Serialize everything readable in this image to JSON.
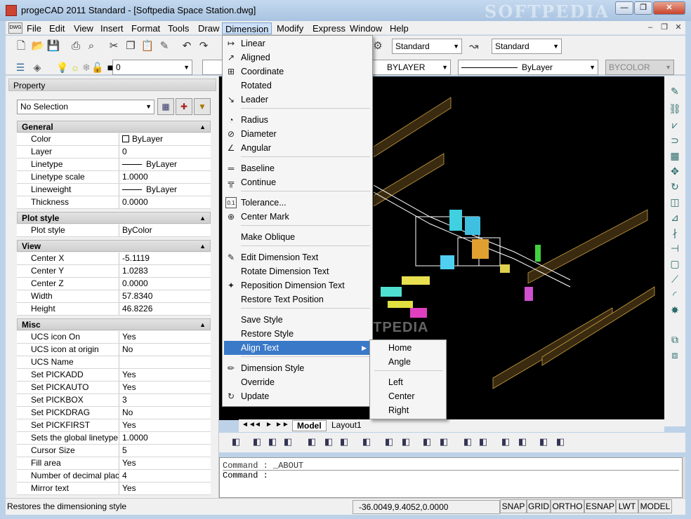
{
  "window": {
    "title": "progeCAD 2011 Standard - [Softpedia Space Station.dwg]",
    "watermark": "SOFTPEDIA",
    "minimize": "0",
    "maximize": "1",
    "close": "r",
    "mdi_minimize": "–",
    "mdi_restore": "❐",
    "mdi_close": "✕"
  },
  "menubar": {
    "items": [
      "File",
      "Edit",
      "View",
      "Insert",
      "Format",
      "Tools",
      "Draw",
      "Dimension",
      "Modify",
      "Express",
      "Window",
      "Help"
    ],
    "active": "Dimension"
  },
  "toolbar": {
    "text_style": "Standard",
    "dim_style": "Standard",
    "layer": "0",
    "layer_name": "BYLAYER",
    "linetype": "ByLayer",
    "color": "BYCOLOR"
  },
  "property_panel": {
    "title": "Property",
    "selection": "No Selection",
    "sections": [
      {
        "name": "General",
        "rows": [
          [
            "Color",
            "ByLayer"
          ],
          [
            "Layer",
            "0"
          ],
          [
            "Linetype",
            "ByLayer"
          ],
          [
            "Linetype scale",
            "1.0000"
          ],
          [
            "Lineweight",
            "ByLayer"
          ],
          [
            "Thickness",
            "0.0000"
          ]
        ]
      },
      {
        "name": "Plot style",
        "rows": [
          [
            "Plot style",
            "ByColor"
          ]
        ]
      },
      {
        "name": "View",
        "rows": [
          [
            "Center X",
            "-5.1119"
          ],
          [
            "Center Y",
            "1.0283"
          ],
          [
            "Center Z",
            "0.0000"
          ],
          [
            "Width",
            "57.8340"
          ],
          [
            "Height",
            "46.8226"
          ]
        ]
      },
      {
        "name": "Misc",
        "rows": [
          [
            "UCS icon On",
            "Yes"
          ],
          [
            "UCS icon at origin",
            "No"
          ],
          [
            "UCS Name",
            ""
          ],
          [
            "Set PICKADD",
            "Yes"
          ],
          [
            "Set PICKAUTO",
            "Yes"
          ],
          [
            "Set PICKBOX",
            "3"
          ],
          [
            "Set PICKDRAG",
            "No"
          ],
          [
            "Set PICKFIRST",
            "Yes"
          ],
          [
            "Sets the global linetype ...",
            "1.0000"
          ],
          [
            "Cursor Size",
            "5"
          ],
          [
            "Fill area",
            "Yes"
          ],
          [
            "Number of decimal places",
            "4"
          ],
          [
            "Mirror text",
            "Yes"
          ]
        ]
      }
    ]
  },
  "dimension_menu": {
    "items": [
      {
        "label": "Linear",
        "icon": "linear-dim-icon",
        "glyph": "↦"
      },
      {
        "label": "Aligned",
        "icon": "aligned-dim-icon",
        "glyph": "↗"
      },
      {
        "label": "Coordinate",
        "icon": "coordinate-dim-icon",
        "glyph": "⊞"
      },
      {
        "label": "Rotated",
        "icon": "",
        "glyph": ""
      },
      {
        "label": "Leader",
        "icon": "leader-icon",
        "glyph": "↘"
      },
      {
        "label": "Radius",
        "icon": "radius-icon",
        "glyph": "◔"
      },
      {
        "label": "Diameter",
        "icon": "diameter-icon",
        "glyph": "⊘"
      },
      {
        "label": "Angular",
        "icon": "angular-icon",
        "glyph": "∠"
      },
      {
        "label": "Baseline",
        "icon": "baseline-icon",
        "glyph": "═"
      },
      {
        "label": "Continue",
        "icon": "continue-icon",
        "glyph": "╦"
      },
      {
        "label": "Tolerance...",
        "icon": "tolerance-icon",
        "glyph": "0.1"
      },
      {
        "label": "Center Mark",
        "icon": "center-mark-icon",
        "glyph": "⊕"
      },
      {
        "label": "Make Oblique",
        "icon": "",
        "glyph": ""
      },
      {
        "label": "Edit Dimension Text",
        "icon": "edit-dim-text-icon",
        "glyph": "✎"
      },
      {
        "label": "Rotate Dimension Text",
        "icon": "",
        "glyph": ""
      },
      {
        "label": "Reposition Dimension Text",
        "icon": "reposition-dim-text-icon",
        "glyph": "✦"
      },
      {
        "label": "Restore Text Position",
        "icon": "",
        "glyph": ""
      },
      {
        "label": "Save Style",
        "icon": "",
        "glyph": ""
      },
      {
        "label": "Restore Style",
        "icon": "",
        "glyph": ""
      },
      {
        "label": "Align Text",
        "icon": "",
        "glyph": "",
        "submenu": true
      },
      {
        "label": "Dimension Style",
        "icon": "dimension-style-icon",
        "glyph": "✏"
      },
      {
        "label": "Override",
        "icon": "",
        "glyph": ""
      },
      {
        "label": "Update",
        "icon": "update-dim-icon",
        "glyph": "↻"
      }
    ],
    "highlighted": "Align Text"
  },
  "align_text_submenu": [
    "Home",
    "Angle",
    "Left",
    "Center",
    "Right"
  ],
  "layout_tabs": [
    "Model",
    "Layout1"
  ],
  "command_line": {
    "history": "Command : _ABOUT",
    "prompt": "Command :"
  },
  "status": {
    "message": "Restores the dimensioning style",
    "coordinates": "-36.0049,9.4052,0.0000",
    "toggles": [
      "SNAP",
      "GRID",
      "ORTHO",
      "ESNAP",
      "LWT",
      "MODEL"
    ]
  },
  "canvas_watermark": "SOFTPEDIA",
  "colors": {
    "title_bar": "#b9d1ea",
    "menu_highlight": "#3a79c8",
    "canvas": "#000000"
  }
}
